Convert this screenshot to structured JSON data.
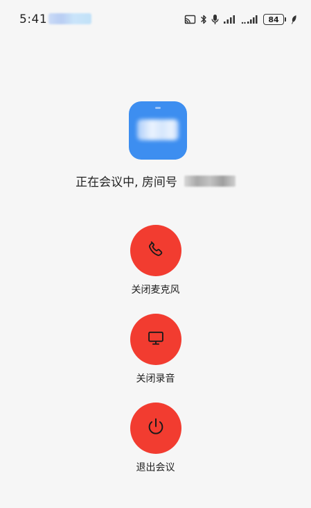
{
  "status_bar": {
    "time": "5:41",
    "battery": "84",
    "icons": [
      "cast-icon",
      "bluetooth-icon",
      "microphone-icon",
      "signal-icon",
      "signal-icon",
      "battery-icon",
      "leaf-icon"
    ]
  },
  "meeting": {
    "status_text": "正在会议中, 房间号"
  },
  "actions": {
    "mute_mic": {
      "label": "关闭麦克风",
      "icon": "phone-icon"
    },
    "stop_recording": {
      "label": "关闭录音",
      "icon": "monitor-icon"
    },
    "leave_meeting": {
      "label": "退出会议",
      "icon": "power-icon"
    }
  },
  "colors": {
    "background": "#f6f6f6",
    "action_red": "#f23c30",
    "app_icon_blue": "#3d8ef0"
  }
}
